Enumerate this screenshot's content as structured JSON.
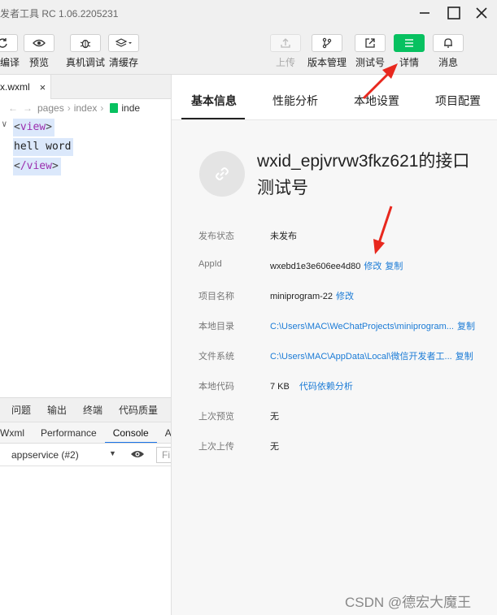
{
  "window": {
    "title": "发者工具 RC 1.06.2205231"
  },
  "toolbar": {
    "compile": "编译",
    "preview": "预览",
    "remote_debug": "真机调试",
    "clear_cache": "清缓存",
    "upload": "上传",
    "version_mgmt": "版本管理",
    "test_account": "测试号",
    "details": "详情",
    "messages": "消息"
  },
  "editor": {
    "file_tab": "x.wxml",
    "close_glyph": "×",
    "breadcrumb": [
      "pages",
      "index",
      "inde"
    ],
    "code": {
      "open_tag": "view",
      "text": "hell word",
      "close_tag": "/view"
    }
  },
  "bottom_panel": {
    "tabs": [
      "问题",
      "输出",
      "终端",
      "代码质量"
    ],
    "devtools_tabs": [
      "Wxml",
      "Performance",
      "Console",
      "A"
    ],
    "active_devtools_tab": "Console",
    "context_select": "appservice (#2)",
    "filter_placeholder": "Fi"
  },
  "detail": {
    "tabs": [
      "基本信息",
      "性能分析",
      "本地设置",
      "项目配置"
    ],
    "active_tab": "基本信息",
    "app_name": "wxid_epjvrvw3fkz621的接口测试号",
    "rows": [
      {
        "key": "发布状态",
        "value": "未发布"
      },
      {
        "key": "AppId",
        "value": "wxebd1e3e606ee4d80",
        "links": [
          "修改",
          "复制"
        ]
      },
      {
        "key": "项目名称",
        "value": "miniprogram-22",
        "links": [
          "修改"
        ]
      },
      {
        "key": "本地目录",
        "value": "C:\\Users\\MAC\\WeChatProjects\\miniprogram...",
        "value_is_link": true,
        "links": [
          "复制"
        ]
      },
      {
        "key": "文件系统",
        "value": "C:\\Users\\MAC\\AppData\\Local\\微信开发者工...",
        "value_is_link": true,
        "links": [
          "复制"
        ]
      },
      {
        "key": "本地代码",
        "value": "7 KB",
        "links": [
          "代码依赖分析"
        ]
      },
      {
        "key": "上次预览",
        "value": "无"
      },
      {
        "key": "上次上传",
        "value": "无"
      }
    ]
  },
  "watermark": "CSDN @德宏大魔王",
  "colors": {
    "accent_green": "#07c160",
    "link_blue": "#1b7bd6",
    "annotation_red": "#e8281e",
    "selection_blue": "#dbe8fb"
  },
  "icons": [
    "refresh-icon",
    "eye-icon",
    "bug-icon",
    "layers-icon",
    "upload-icon",
    "branch-icon",
    "external-link-icon",
    "menu-icon",
    "bell-icon",
    "link-icon"
  ]
}
